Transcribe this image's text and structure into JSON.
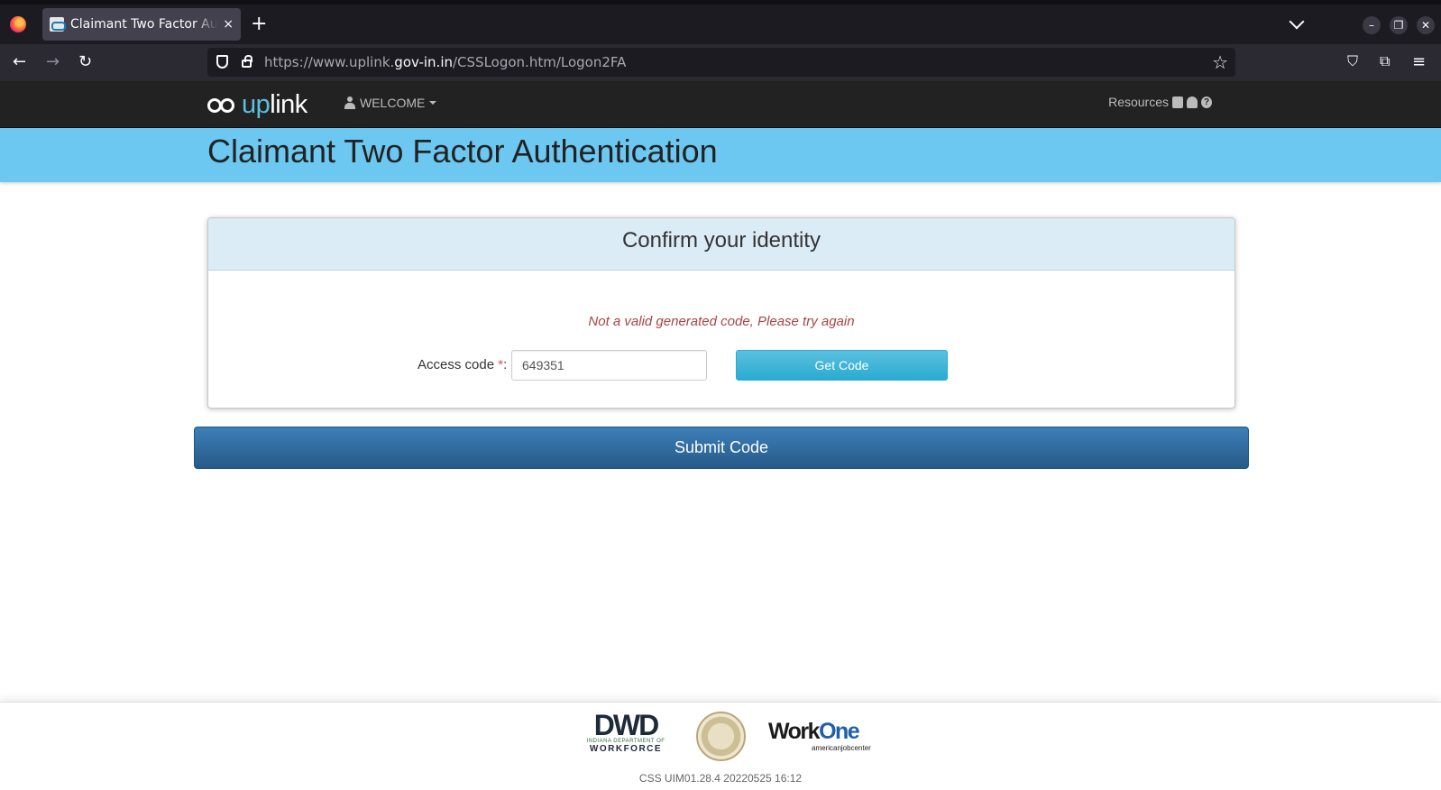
{
  "browser": {
    "tab_title": "Claimant Two Factor Authentication",
    "tab_close": "×",
    "new_tab": "+",
    "url_host": "https://www.uplink.",
    "url_domain": "gov-in.in",
    "url_path": "/CSSLogon.htm/Logon2FA"
  },
  "header": {
    "logo_a": "up",
    "logo_b": "link",
    "welcome": "WELCOME",
    "resources": "Resources"
  },
  "page": {
    "title": "Claimant Two Factor Authentication"
  },
  "panel": {
    "title": "Confirm your identity",
    "error": "Not a valid generated code, Please try again",
    "access_label": "Access code",
    "required": "*",
    "colon": ":",
    "access_value": "649351",
    "get_code": "Get Code"
  },
  "submit_label": "Submit Code",
  "footer": {
    "dwd_big": "DWD",
    "dwd_small": "INDIANA DEPARTMENT OF",
    "dwd_wf": "WORKFORCE",
    "workone_a": "Work",
    "workone_b": "One",
    "ajc": "americanjobcenter",
    "version": "CSS UIM01.28.4 20220525 16:12"
  }
}
